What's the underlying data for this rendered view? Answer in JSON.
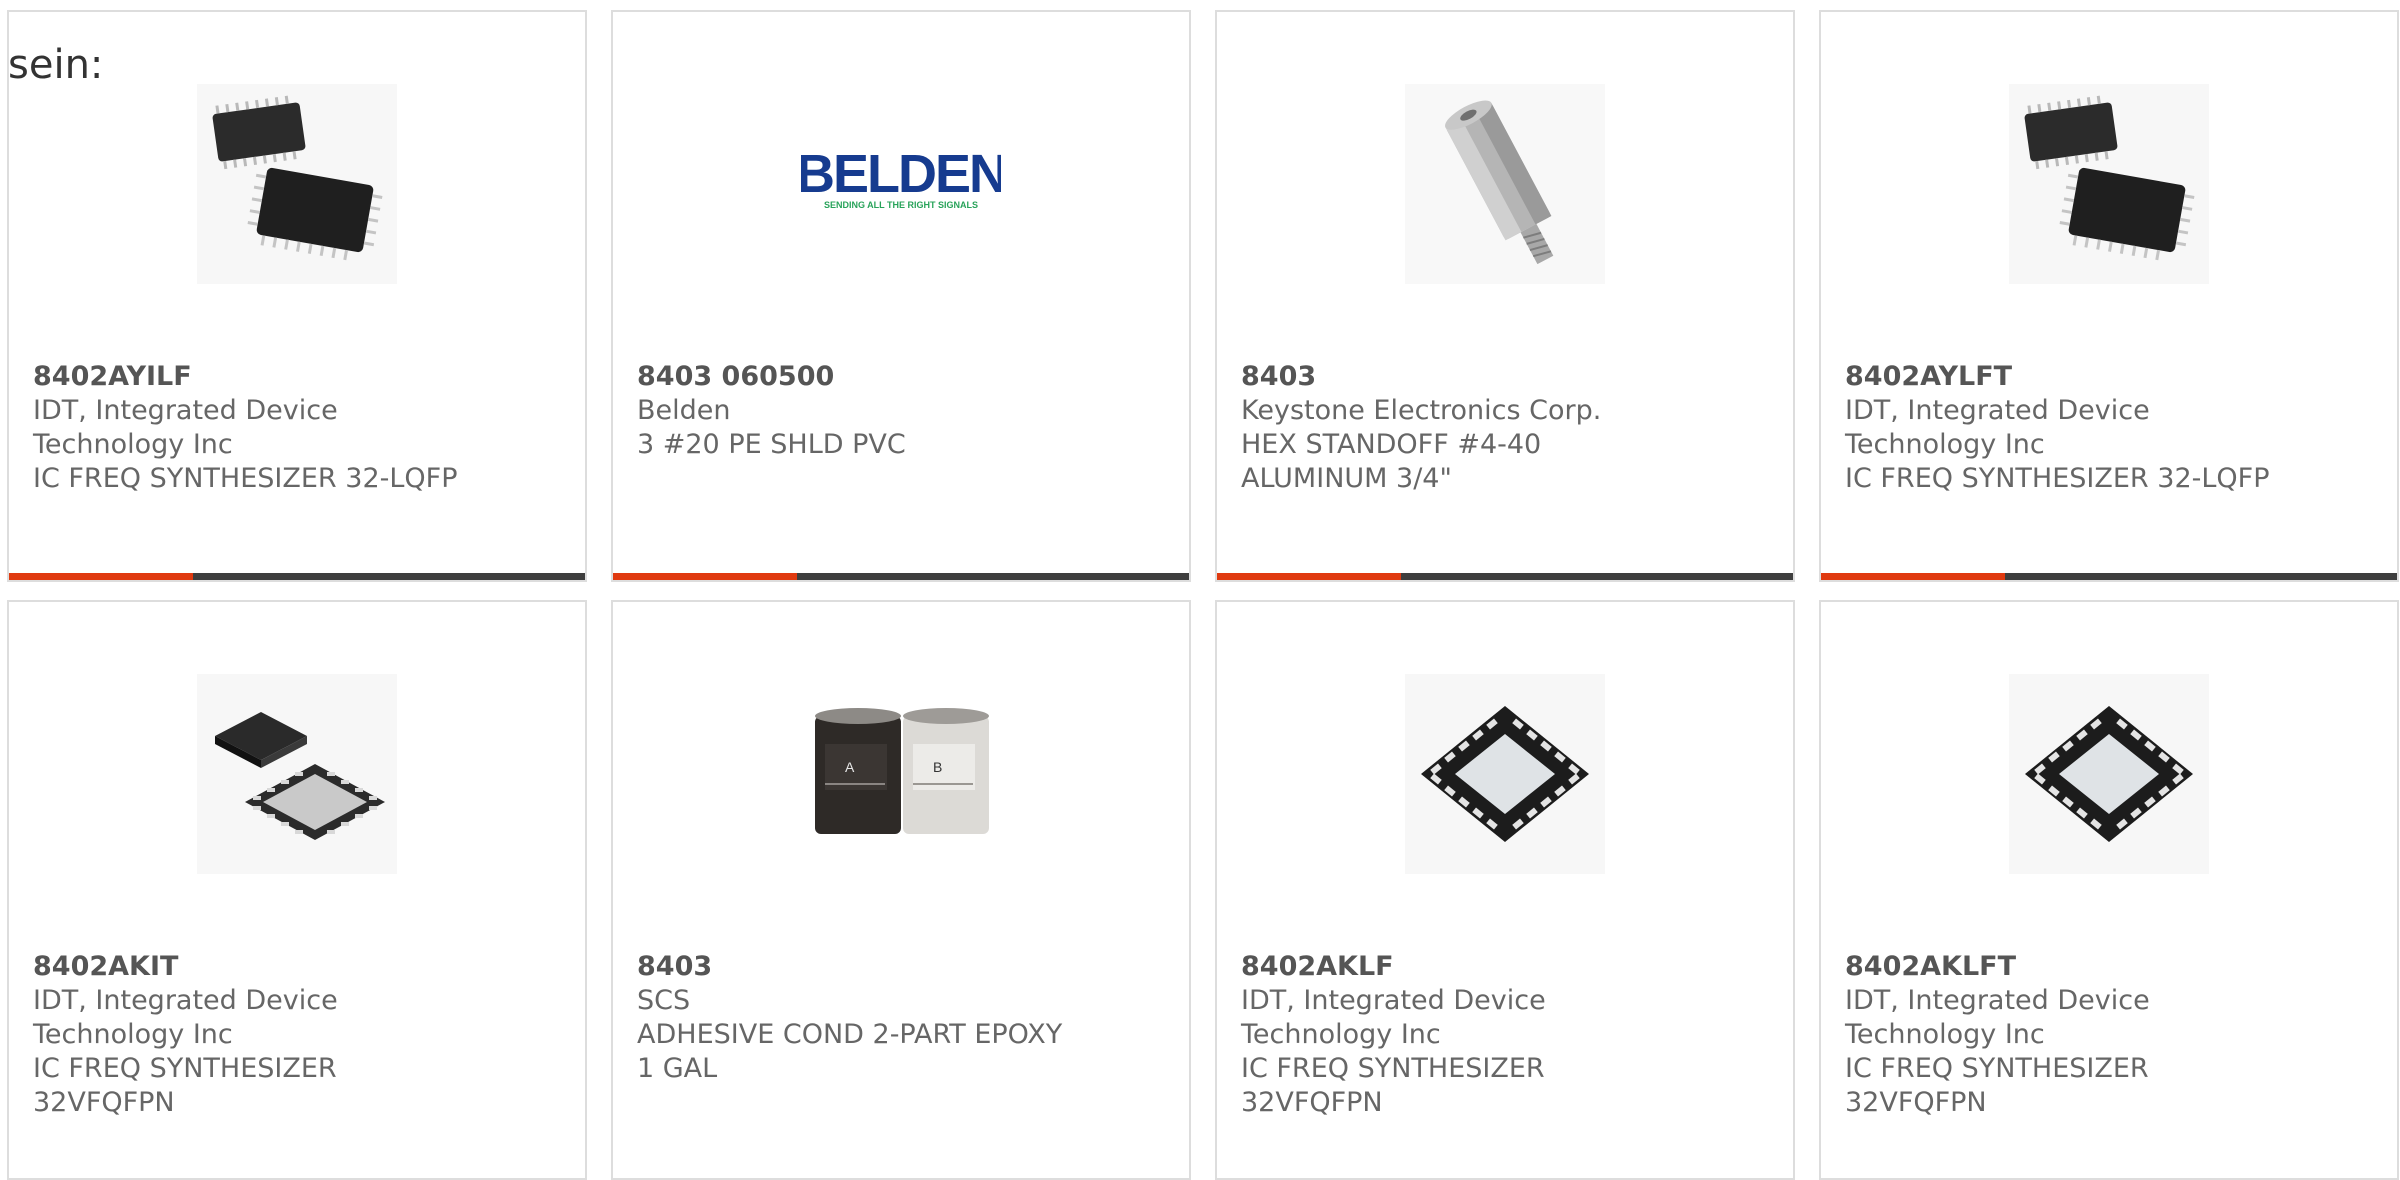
{
  "lead_text": "sein:",
  "colors": {
    "accent": "#e03a10",
    "bar": "#3e3e3e",
    "border": "#dddddd",
    "text": "#666666"
  },
  "products": [
    {
      "part_number": "8402AYILF",
      "manufacturer_line1": "IDT, Integrated Device",
      "manufacturer_line2": "Technology Inc",
      "description_line1": "IC FREQ SYNTHESIZER 32-LQFP",
      "description_line2": "",
      "image": "lqfp-chip-pair-image"
    },
    {
      "part_number": "8403 060500",
      "manufacturer_line1": "Belden",
      "manufacturer_line2": "",
      "description_line1": "3 #20 PE SHLD PVC",
      "description_line2": "",
      "image": "belden-logo-image",
      "logo_text": "BELDEN",
      "logo_tagline": "SENDING ALL THE RIGHT SIGNALS"
    },
    {
      "part_number": "8403",
      "manufacturer_line1": "Keystone Electronics Corp.",
      "manufacturer_line2": "",
      "description_line1": "HEX STANDOFF #4-40",
      "description_line2": "ALUMINUM 3/4\"",
      "image": "hex-standoff-image"
    },
    {
      "part_number": "8402AYLFT",
      "manufacturer_line1": "IDT, Integrated Device",
      "manufacturer_line2": "Technology Inc",
      "description_line1": "IC FREQ SYNTHESIZER 32-LQFP",
      "description_line2": "",
      "image": "lqfp-chip-pair-image"
    },
    {
      "part_number": "8402AKIT",
      "manufacturer_line1": "IDT, Integrated Device",
      "manufacturer_line2": "Technology Inc",
      "description_line1": "IC FREQ SYNTHESIZER",
      "description_line2": "32VFQFPN",
      "image": "vfqfpn-chip-pair-image"
    },
    {
      "part_number": "8403",
      "manufacturer_line1": "SCS",
      "manufacturer_line2": "",
      "description_line1": "ADHESIVE COND 2-PART EPOXY",
      "description_line2": "1 GAL",
      "image": "epoxy-cans-image",
      "can_a_label": "A",
      "can_b_label": "B"
    },
    {
      "part_number": "8402AKLF",
      "manufacturer_line1": "IDT, Integrated Device",
      "manufacturer_line2": "Technology Inc",
      "description_line1": "IC FREQ SYNTHESIZER",
      "description_line2": "32VFQFPN",
      "image": "qfn-chip-image"
    },
    {
      "part_number": "8402AKLFT",
      "manufacturer_line1": "IDT, Integrated Device",
      "manufacturer_line2": "Technology Inc",
      "description_line1": "IC FREQ SYNTHESIZER",
      "description_line2": "32VFQFPN",
      "image": "qfn-chip-image"
    }
  ]
}
